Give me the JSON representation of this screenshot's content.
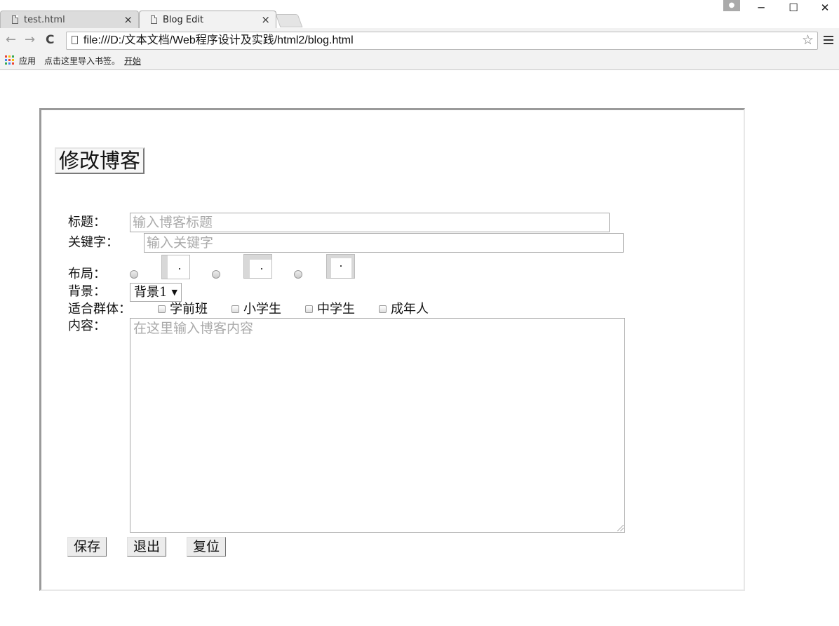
{
  "browser": {
    "tabs": [
      {
        "label": "test.html",
        "active": false
      },
      {
        "label": "Blog Edit",
        "active": true
      }
    ],
    "close_glyph": "×",
    "window_controls": {
      "minimize": "─",
      "maximize": "☐",
      "close": "✕"
    },
    "nav": {
      "back": "←",
      "forward": "→",
      "reload": "C"
    },
    "address": "file:///D:/文本文档/Web程序设计及实践/html2/blog.html",
    "star_glyph": "☆",
    "bookmarks": {
      "apps_label": "应用",
      "import_text": "点击这里导入书签。",
      "start_link": "开始"
    },
    "apps_colors": [
      "#e94235",
      "#fbbc04",
      "#34a853",
      "#4285f4",
      "#e94235",
      "#fbbc04",
      "#34a853",
      "#4285f4",
      "#e94235"
    ]
  },
  "form": {
    "heading": "修改博客",
    "title_label": "标题：",
    "title_placeholder": "输入博客标题",
    "keyword_label": "关键字：",
    "keyword_placeholder": "输入关键字",
    "layout_label": "布局：",
    "background_label": "背景：",
    "background_selected": "背景1",
    "audience_label": "适合群体：",
    "audience_options": [
      "学前班",
      "小学生",
      "中学生",
      "成年人"
    ],
    "content_label": "内容：",
    "content_placeholder": "在这里输入博客内容",
    "buttons": {
      "save": "保存",
      "exit": "退出",
      "reset": "复位"
    }
  }
}
